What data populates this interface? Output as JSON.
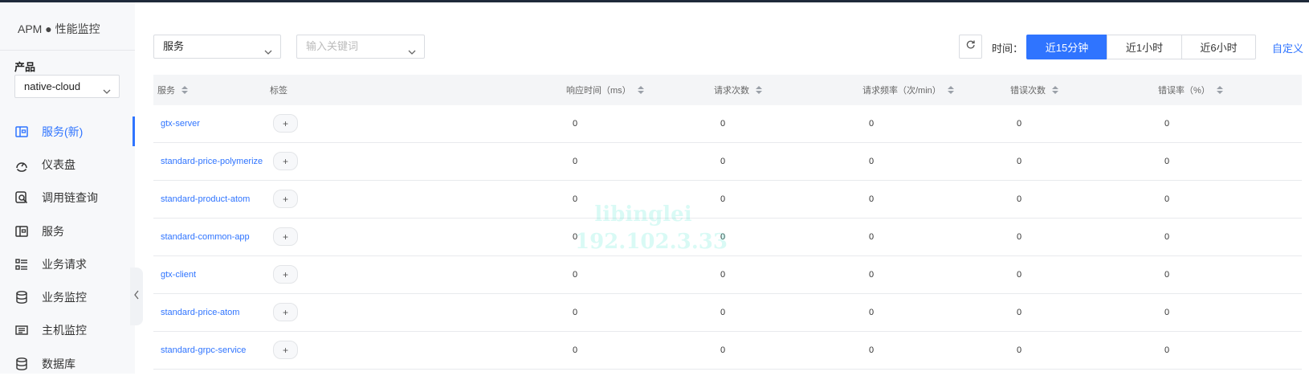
{
  "sidebar": {
    "brand": "APM ● 性能监控",
    "product_label": "产品",
    "product_value": "native-cloud",
    "items": [
      {
        "label": "服务(新)",
        "icon": "service-panel-icon",
        "active": true
      },
      {
        "label": "仪表盘",
        "icon": "dashboard-gauge-icon",
        "active": false
      },
      {
        "label": "调用链查询",
        "icon": "trace-search-icon",
        "active": false
      },
      {
        "label": "服务",
        "icon": "service-panel-icon",
        "active": false
      },
      {
        "label": "业务请求",
        "icon": "list-grid-icon",
        "active": false
      },
      {
        "label": "业务监控",
        "icon": "database-stack-icon",
        "active": false
      },
      {
        "label": "主机监控",
        "icon": "host-card-icon",
        "active": false
      },
      {
        "label": "数据库",
        "icon": "database-icon",
        "active": false
      }
    ]
  },
  "toolbar": {
    "service_select": "服务",
    "keyword_placeholder": "输入关键词",
    "time_label": "时间：",
    "time_options": [
      "近15分钟",
      "近1小时",
      "近6小时"
    ],
    "time_selected": "近15分钟",
    "custom_label": "自定义"
  },
  "table": {
    "headers": [
      "服务",
      "标签",
      "响应时间（ms）",
      "请求次数",
      "请求频率（次/min）",
      "错误次数",
      "错误率（%）"
    ],
    "tag_button": "+",
    "rows": [
      {
        "service": "gtx-server",
        "response": "0",
        "requests": "0",
        "freq": "0",
        "errors": "0",
        "error_rate": "0"
      },
      {
        "service": "standard-price-polymerize",
        "response": "0",
        "requests": "0",
        "freq": "0",
        "errors": "0",
        "error_rate": "0"
      },
      {
        "service": "standard-product-atom",
        "response": "0",
        "requests": "0",
        "freq": "0",
        "errors": "0",
        "error_rate": "0"
      },
      {
        "service": "standard-common-app",
        "response": "0",
        "requests": "0",
        "freq": "0",
        "errors": "0",
        "error_rate": "0"
      },
      {
        "service": "gtx-client",
        "response": "0",
        "requests": "0",
        "freq": "0",
        "errors": "0",
        "error_rate": "0"
      },
      {
        "service": "standard-price-atom",
        "response": "0",
        "requests": "0",
        "freq": "0",
        "errors": "0",
        "error_rate": "0"
      },
      {
        "service": "standard-grpc-service",
        "response": "0",
        "requests": "0",
        "freq": "0",
        "errors": "0",
        "error_rate": "0"
      }
    ]
  },
  "watermark": {
    "line1": "libinglei",
    "line2": "192.102.3.33"
  },
  "colors": {
    "accent": "#2f74ff",
    "sidebar_bg": "#f7f8fa",
    "header_bg": "#f4f5f7"
  }
}
